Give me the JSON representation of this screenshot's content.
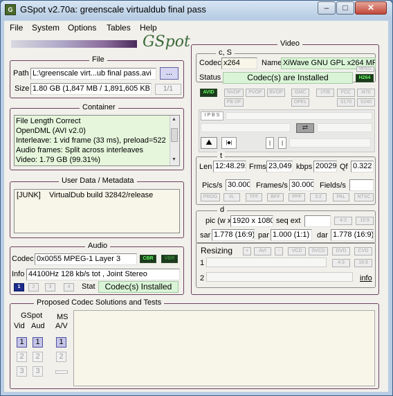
{
  "window": {
    "title": "GSpot v2.70a: greenscale virtualdub final pass",
    "minimize": "–",
    "maximize": "□",
    "close": "✕"
  },
  "menu": {
    "file": "File",
    "system": "System",
    "options": "Options",
    "tables": "Tables",
    "help": "Help"
  },
  "logo": "GSpot",
  "file": {
    "title": "File",
    "path_label": "Path",
    "path_value": "L:\\greenscale virt...ub final pass.avi",
    "browse": "...",
    "size_label": "Size",
    "size_value": "1.80 GB (1,847 MB / 1,891,605 KB",
    "page": "1/1"
  },
  "container": {
    "title": "Container",
    "lines": [
      "File Length Correct",
      "OpenDML (AVI v2.0)",
      "Interleave: 1 vid frame (33 ms), preload=522",
      "Audio frames: Split across interleaves",
      "Video: 1.79 GB (99.31%)"
    ]
  },
  "userdata": {
    "title": "User Data / Metadata",
    "tag": "[JUNK]",
    "value": "VirtualDub build 32842/release"
  },
  "audio": {
    "title": "Audio",
    "codec_label": "Codec",
    "codec_value": "0x0055 MPEG-1 Layer 3",
    "cbr": "CBR",
    "vbr": "VBR",
    "info_label": "Info",
    "info_value": "44100Hz  128 kb/s tot , Joint Stereo",
    "stream_buttons": [
      "1",
      "2",
      "3",
      "4"
    ],
    "stat_label": "Stat",
    "stat_value": "Codec(s) Installed"
  },
  "video": {
    "title": "Video",
    "cs_label": "c, S",
    "codec_label": "Codec",
    "codec_value": "x264",
    "name_label": "Name",
    "name_value": "XiWave GNU GPL x264 MPEG-4",
    "name_badge1": "MPEG",
    "status_label": "Status",
    "status_value": "Codec(s) are Installed",
    "h264": "H264",
    "flag_buttons": [
      "AVID",
      "NVOP",
      "PVOP",
      "BVOP",
      "GMC",
      "I709",
      "FCC",
      "I470",
      "PB DF",
      "OPEL",
      "S170",
      "S240"
    ],
    "ipbs": "I P B S",
    "t_label": "t",
    "len_label": "Len",
    "len_value": "12:48.292",
    "frms_label": "Frms",
    "frms_value": "23,049",
    "kbps_label": "kbps",
    "kbps_value": "20029",
    "qf_label": "Qf",
    "qf_value": "0.322",
    "pics_label": "Pics/s",
    "pics_value": "30.000",
    "frames_label": "Frames/s",
    "frames_value": "30.000",
    "fields_label": "Fields/s",
    "rate_buttons": [
      "PROG",
      "I/L",
      "TFF",
      "BFF",
      "PPF",
      "3:2",
      "PAL",
      "NTSC"
    ],
    "d_label": "d",
    "pic_label": "pic (w x",
    "pic_value": "1920 x 1080",
    "seqext_label": "seq ext",
    "r43": "4:3",
    "r169": "16:9",
    "sar_label": "sar",
    "sar_value": "1.778 (16:9)",
    "par_label": "par",
    "par_value": "1.000 (1:1)",
    "dar_label": "dar",
    "dar_value": "1.778 (16:9)",
    "resizing_label": "Resizing",
    "resize_buttons": [
      "+",
      "AVI",
      "-",
      "VCD",
      "SVCD",
      "DVD",
      "CVD"
    ],
    "row1": "1",
    "row2": "2",
    "r43b": "4:3",
    "r169b": "16:9",
    "info_link": "info"
  },
  "proposed": {
    "title": "Proposed Codec Solutions and Tests",
    "gspot_label": "GSpot",
    "vid_label": "Vid",
    "aud_label": "Aud",
    "ms_label": "MS",
    "av_label": "A/V",
    "vid_buttons": [
      "1",
      "2",
      "3"
    ],
    "aud_buttons": [
      "1",
      "2",
      "3"
    ],
    "ms_buttons": [
      "1",
      "2"
    ]
  }
}
